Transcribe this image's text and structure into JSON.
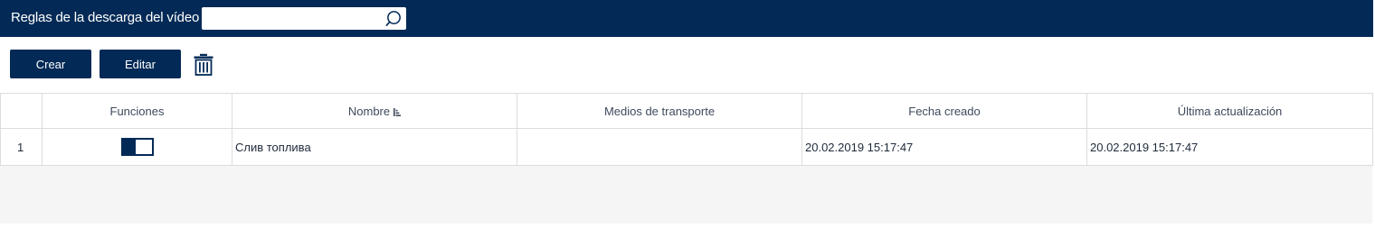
{
  "header": {
    "title": "Reglas de la descarga del vídeo",
    "search": {
      "value": "",
      "placeholder": ""
    },
    "search_icon": "search-icon"
  },
  "toolbar": {
    "create_label": "Crear",
    "edit_label": "Editar",
    "delete_icon": "trash-icon"
  },
  "table": {
    "columns": [
      "",
      "Funciones",
      "Nombre",
      "Medios de transporte",
      "Fecha creado",
      "Última actualización"
    ],
    "sort_column": "Nombre",
    "sort_direction": "ascending",
    "rows": [
      {
        "index": "1",
        "enabled": true,
        "name": "Слив топлива",
        "transport": "",
        "created": "20.02.2019 15:17:47",
        "updated": "20.02.2019 15:17:47"
      }
    ]
  },
  "colors": {
    "brand": "#032a56",
    "table_border": "#dcdcdc",
    "empty_area": "#f5f5f5"
  }
}
